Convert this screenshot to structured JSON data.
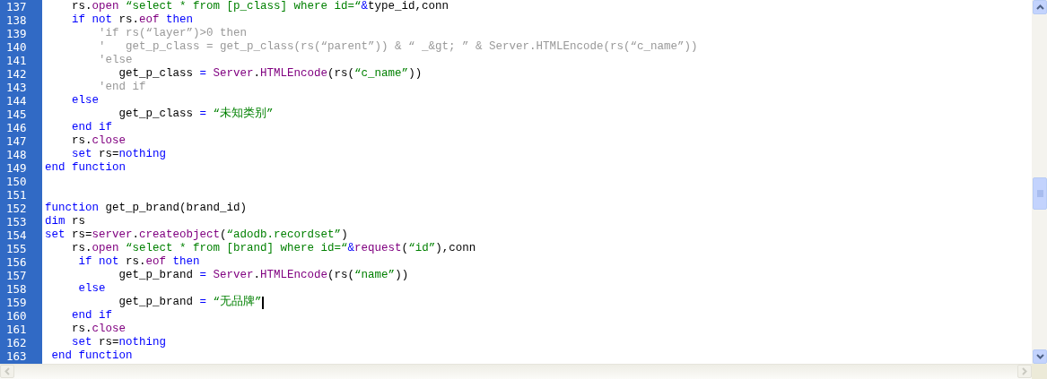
{
  "editor": {
    "lines": [
      {
        "number": "137",
        "tokens": [
          {
            "kind": "plain",
            "text": "    rs."
          },
          {
            "kind": "member",
            "text": "open"
          },
          {
            "kind": "string",
            "text": " “select * from [p_class] where id=“"
          },
          {
            "kind": "keyword",
            "text": "&"
          },
          {
            "kind": "plain",
            "text": "type_id,conn"
          }
        ]
      },
      {
        "number": "138",
        "tokens": [
          {
            "kind": "keyword",
            "text": "    if not"
          },
          {
            "kind": "plain",
            "text": " rs."
          },
          {
            "kind": "member",
            "text": "eof"
          },
          {
            "kind": "keyword",
            "text": " then"
          }
        ]
      },
      {
        "number": "139",
        "tokens": [
          {
            "kind": "comment",
            "text": "        'if rs(“layer”)>0 then"
          }
        ]
      },
      {
        "number": "140",
        "tokens": [
          {
            "kind": "comment",
            "text": "        '   get_p_class = get_p_class(rs(“parent”)) & “ _&gt; ” & Server.HTMLEncode(rs(“c_name”))"
          }
        ]
      },
      {
        "number": "141",
        "tokens": [
          {
            "kind": "comment",
            "text": "        'else"
          }
        ]
      },
      {
        "number": "142",
        "tokens": [
          {
            "kind": "plain",
            "text": "           get_p_class "
          },
          {
            "kind": "keyword",
            "text": "="
          },
          {
            "kind": "member",
            "text": " Server"
          },
          {
            "kind": "plain",
            "text": "."
          },
          {
            "kind": "member",
            "text": "HTMLEncode"
          },
          {
            "kind": "plain",
            "text": "(rs("
          },
          {
            "kind": "string",
            "text": "“c_name”"
          },
          {
            "kind": "plain",
            "text": "))"
          }
        ]
      },
      {
        "number": "143",
        "tokens": [
          {
            "kind": "comment",
            "text": "        'end if"
          }
        ]
      },
      {
        "number": "144",
        "tokens": [
          {
            "kind": "keyword",
            "text": "    else"
          }
        ]
      },
      {
        "number": "145",
        "tokens": [
          {
            "kind": "plain",
            "text": "           get_p_class "
          },
          {
            "kind": "keyword",
            "text": "="
          },
          {
            "kind": "string",
            "text": " “未知类别”"
          }
        ]
      },
      {
        "number": "146",
        "tokens": [
          {
            "kind": "keyword",
            "text": "    end if"
          }
        ]
      },
      {
        "number": "147",
        "tokens": [
          {
            "kind": "plain",
            "text": "    rs."
          },
          {
            "kind": "member",
            "text": "close"
          }
        ]
      },
      {
        "number": "148",
        "tokens": [
          {
            "kind": "keyword",
            "text": "    set"
          },
          {
            "kind": "plain",
            "text": " rs="
          },
          {
            "kind": "keyword",
            "text": "nothing"
          }
        ]
      },
      {
        "number": "149",
        "tokens": [
          {
            "kind": "keyword",
            "text": "end function"
          }
        ]
      },
      {
        "number": "150"
      },
      {
        "number": "151"
      },
      {
        "number": "152",
        "tokens": [
          {
            "kind": "keyword",
            "text": "function"
          },
          {
            "kind": "plain",
            "text": " get_p_brand(brand_id)"
          }
        ]
      },
      {
        "number": "153",
        "tokens": [
          {
            "kind": "keyword",
            "text": "dim"
          },
          {
            "kind": "plain",
            "text": " rs"
          }
        ]
      },
      {
        "number": "154",
        "tokens": [
          {
            "kind": "keyword",
            "text": "set"
          },
          {
            "kind": "plain",
            "text": " rs="
          },
          {
            "kind": "member",
            "text": "server"
          },
          {
            "kind": "plain",
            "text": "."
          },
          {
            "kind": "member",
            "text": "createobject"
          },
          {
            "kind": "plain",
            "text": "("
          },
          {
            "kind": "string",
            "text": "“adodb.recordset”"
          },
          {
            "kind": "plain",
            "text": ")"
          }
        ]
      },
      {
        "number": "155",
        "tokens": [
          {
            "kind": "plain",
            "text": "    rs."
          },
          {
            "kind": "member",
            "text": "open"
          },
          {
            "kind": "string",
            "text": " “select * from [brand] where id=“"
          },
          {
            "kind": "keyword",
            "text": "&"
          },
          {
            "kind": "member",
            "text": "request"
          },
          {
            "kind": "plain",
            "text": "("
          },
          {
            "kind": "string",
            "text": "“id”"
          },
          {
            "kind": "plain",
            "text": "),conn"
          }
        ]
      },
      {
        "number": "156",
        "tokens": [
          {
            "kind": "keyword",
            "text": "     if not"
          },
          {
            "kind": "plain",
            "text": " rs."
          },
          {
            "kind": "member",
            "text": "eof"
          },
          {
            "kind": "keyword",
            "text": " then"
          }
        ]
      },
      {
        "number": "157",
        "tokens": [
          {
            "kind": "plain",
            "text": "           get_p_brand "
          },
          {
            "kind": "keyword",
            "text": "="
          },
          {
            "kind": "member",
            "text": " Server"
          },
          {
            "kind": "plain",
            "text": "."
          },
          {
            "kind": "member",
            "text": "HTMLEncode"
          },
          {
            "kind": "plain",
            "text": "(rs("
          },
          {
            "kind": "string",
            "text": "“name”"
          },
          {
            "kind": "plain",
            "text": "))"
          }
        ]
      },
      {
        "number": "158",
        "tokens": [
          {
            "kind": "keyword",
            "text": "     else"
          }
        ]
      },
      {
        "number": "159",
        "cursor": true,
        "tokens": [
          {
            "kind": "plain",
            "text": "           get_p_brand "
          },
          {
            "kind": "keyword",
            "text": "="
          },
          {
            "kind": "string",
            "text": " “无品牌”"
          }
        ]
      },
      {
        "number": "160",
        "tokens": [
          {
            "kind": "keyword",
            "text": "    end if"
          }
        ]
      },
      {
        "number": "161",
        "tokens": [
          {
            "kind": "plain",
            "text": "    rs."
          },
          {
            "kind": "member",
            "text": "close"
          }
        ]
      },
      {
        "number": "162",
        "tokens": [
          {
            "kind": "keyword",
            "text": "    set"
          },
          {
            "kind": "plain",
            "text": " rs="
          },
          {
            "kind": "keyword",
            "text": "nothing"
          }
        ]
      },
      {
        "number": "163",
        "tokens": [
          {
            "kind": "keyword",
            "text": " end function"
          }
        ]
      }
    ]
  }
}
